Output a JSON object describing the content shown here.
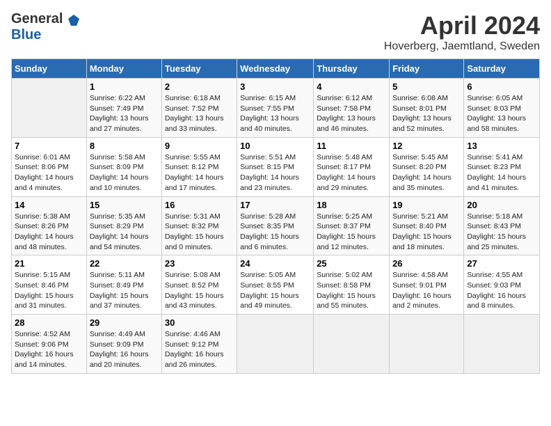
{
  "header": {
    "logo_general": "General",
    "logo_blue": "Blue",
    "month_title": "April 2024",
    "location": "Hoverberg, Jaemtland, Sweden"
  },
  "weekdays": [
    "Sunday",
    "Monday",
    "Tuesday",
    "Wednesday",
    "Thursday",
    "Friday",
    "Saturday"
  ],
  "weeks": [
    [
      {
        "day": "",
        "info": ""
      },
      {
        "day": "1",
        "info": "Sunrise: 6:22 AM\nSunset: 7:49 PM\nDaylight: 13 hours\nand 27 minutes."
      },
      {
        "day": "2",
        "info": "Sunrise: 6:18 AM\nSunset: 7:52 PM\nDaylight: 13 hours\nand 33 minutes."
      },
      {
        "day": "3",
        "info": "Sunrise: 6:15 AM\nSunset: 7:55 PM\nDaylight: 13 hours\nand 40 minutes."
      },
      {
        "day": "4",
        "info": "Sunrise: 6:12 AM\nSunset: 7:58 PM\nDaylight: 13 hours\nand 46 minutes."
      },
      {
        "day": "5",
        "info": "Sunrise: 6:08 AM\nSunset: 8:01 PM\nDaylight: 13 hours\nand 52 minutes."
      },
      {
        "day": "6",
        "info": "Sunrise: 6:05 AM\nSunset: 8:03 PM\nDaylight: 13 hours\nand 58 minutes."
      }
    ],
    [
      {
        "day": "7",
        "info": "Sunrise: 6:01 AM\nSunset: 8:06 PM\nDaylight: 14 hours\nand 4 minutes."
      },
      {
        "day": "8",
        "info": "Sunrise: 5:58 AM\nSunset: 8:09 PM\nDaylight: 14 hours\nand 10 minutes."
      },
      {
        "day": "9",
        "info": "Sunrise: 5:55 AM\nSunset: 8:12 PM\nDaylight: 14 hours\nand 17 minutes."
      },
      {
        "day": "10",
        "info": "Sunrise: 5:51 AM\nSunset: 8:15 PM\nDaylight: 14 hours\nand 23 minutes."
      },
      {
        "day": "11",
        "info": "Sunrise: 5:48 AM\nSunset: 8:17 PM\nDaylight: 14 hours\nand 29 minutes."
      },
      {
        "day": "12",
        "info": "Sunrise: 5:45 AM\nSunset: 8:20 PM\nDaylight: 14 hours\nand 35 minutes."
      },
      {
        "day": "13",
        "info": "Sunrise: 5:41 AM\nSunset: 8:23 PM\nDaylight: 14 hours\nand 41 minutes."
      }
    ],
    [
      {
        "day": "14",
        "info": "Sunrise: 5:38 AM\nSunset: 8:26 PM\nDaylight: 14 hours\nand 48 minutes."
      },
      {
        "day": "15",
        "info": "Sunrise: 5:35 AM\nSunset: 8:29 PM\nDaylight: 14 hours\nand 54 minutes."
      },
      {
        "day": "16",
        "info": "Sunrise: 5:31 AM\nSunset: 8:32 PM\nDaylight: 15 hours\nand 0 minutes."
      },
      {
        "day": "17",
        "info": "Sunrise: 5:28 AM\nSunset: 8:35 PM\nDaylight: 15 hours\nand 6 minutes."
      },
      {
        "day": "18",
        "info": "Sunrise: 5:25 AM\nSunset: 8:37 PM\nDaylight: 15 hours\nand 12 minutes."
      },
      {
        "day": "19",
        "info": "Sunrise: 5:21 AM\nSunset: 8:40 PM\nDaylight: 15 hours\nand 18 minutes."
      },
      {
        "day": "20",
        "info": "Sunrise: 5:18 AM\nSunset: 8:43 PM\nDaylight: 15 hours\nand 25 minutes."
      }
    ],
    [
      {
        "day": "21",
        "info": "Sunrise: 5:15 AM\nSunset: 8:46 PM\nDaylight: 15 hours\nand 31 minutes."
      },
      {
        "day": "22",
        "info": "Sunrise: 5:11 AM\nSunset: 8:49 PM\nDaylight: 15 hours\nand 37 minutes."
      },
      {
        "day": "23",
        "info": "Sunrise: 5:08 AM\nSunset: 8:52 PM\nDaylight: 15 hours\nand 43 minutes."
      },
      {
        "day": "24",
        "info": "Sunrise: 5:05 AM\nSunset: 8:55 PM\nDaylight: 15 hours\nand 49 minutes."
      },
      {
        "day": "25",
        "info": "Sunrise: 5:02 AM\nSunset: 8:58 PM\nDaylight: 15 hours\nand 55 minutes."
      },
      {
        "day": "26",
        "info": "Sunrise: 4:58 AM\nSunset: 9:01 PM\nDaylight: 16 hours\nand 2 minutes."
      },
      {
        "day": "27",
        "info": "Sunrise: 4:55 AM\nSunset: 9:03 PM\nDaylight: 16 hours\nand 8 minutes."
      }
    ],
    [
      {
        "day": "28",
        "info": "Sunrise: 4:52 AM\nSunset: 9:06 PM\nDaylight: 16 hours\nand 14 minutes."
      },
      {
        "day": "29",
        "info": "Sunrise: 4:49 AM\nSunset: 9:09 PM\nDaylight: 16 hours\nand 20 minutes."
      },
      {
        "day": "30",
        "info": "Sunrise: 4:46 AM\nSunset: 9:12 PM\nDaylight: 16 hours\nand 26 minutes."
      },
      {
        "day": "",
        "info": ""
      },
      {
        "day": "",
        "info": ""
      },
      {
        "day": "",
        "info": ""
      },
      {
        "day": "",
        "info": ""
      }
    ]
  ]
}
